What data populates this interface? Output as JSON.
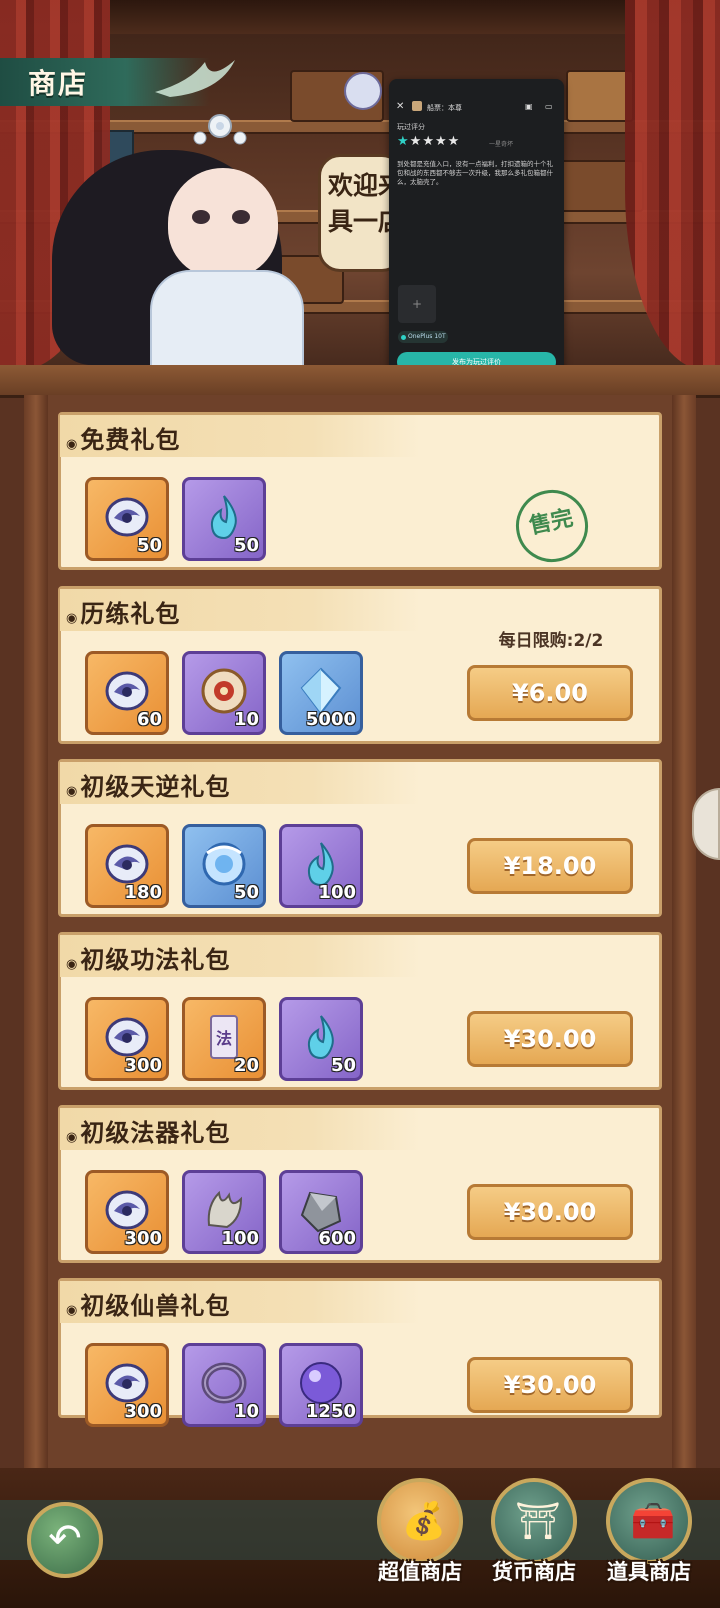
{
  "header": {
    "title": "商店"
  },
  "npc": {
    "speech": "欢迎来到\n具一店"
  },
  "review_panel": {
    "app_name": "船票：本尊",
    "section_label": "玩过评分",
    "stars_filled": 1,
    "stars_total": 5,
    "rating_hint": "一星奇坏",
    "body": "到处都是充值入口，没有一点福利，打扣遗箱的十个礼包和战的东西都不够去一次升级，我那么多礼包箱都什么，太脑壳了。",
    "add_symbol": "+",
    "device_tag": "OnePlus 10T",
    "submit_label": "发布为玩过评价"
  },
  "packs": [
    {
      "title": "免费礼包",
      "items": [
        {
          "type": "spirit-orb",
          "bg": "orange",
          "count": "50"
        },
        {
          "type": "blue-flame",
          "bg": "purple",
          "count": "50"
        }
      ],
      "status": "sold-out",
      "stamp": "售完"
    },
    {
      "title": "历练礼包",
      "items": [
        {
          "type": "spirit-orb",
          "bg": "orange",
          "count": "60"
        },
        {
          "type": "compass-disc",
          "bg": "purple",
          "count": "10"
        },
        {
          "type": "crystal",
          "bg": "blue",
          "count": "5000"
        }
      ],
      "limit": "每日限购:2/2",
      "price": "¥6.00"
    },
    {
      "title": "初级天逆礼包",
      "items": [
        {
          "type": "spirit-orb",
          "bg": "orange",
          "count": "180"
        },
        {
          "type": "ice-orb",
          "bg": "blue",
          "count": "50"
        },
        {
          "type": "blue-flame",
          "bg": "purple",
          "count": "100"
        }
      ],
      "price": "¥18.00"
    },
    {
      "title": "初级功法礼包",
      "items": [
        {
          "type": "spirit-orb",
          "bg": "orange",
          "count": "300"
        },
        {
          "type": "talisman",
          "bg": "orange",
          "count": "20",
          "label": "法"
        },
        {
          "type": "blue-flame",
          "bg": "purple",
          "count": "50"
        }
      ],
      "price": "¥30.00"
    },
    {
      "title": "初级法器礼包",
      "items": [
        {
          "type": "spirit-orb",
          "bg": "orange",
          "count": "300"
        },
        {
          "type": "claw-relic",
          "bg": "purple",
          "count": "100"
        },
        {
          "type": "ore",
          "bg": "purple",
          "count": "600"
        }
      ],
      "price": "¥30.00"
    },
    {
      "title": "初级仙兽礼包",
      "items": [
        {
          "type": "spirit-orb",
          "bg": "orange",
          "count": "300"
        },
        {
          "type": "ring",
          "bg": "purple",
          "count": "10"
        },
        {
          "type": "purple-pearl",
          "bg": "purple",
          "count": "1250"
        }
      ],
      "price": "¥30.00"
    }
  ],
  "nav": {
    "back_icon": "back-arrow-icon",
    "tabs": [
      {
        "label": "超值商店",
        "icon": "money-bag-icon",
        "active": true
      },
      {
        "label": "货币商店",
        "icon": "coin-pavilion-icon",
        "active": false
      },
      {
        "label": "道具商店",
        "icon": "treasure-chest-icon",
        "active": false
      }
    ]
  },
  "colors": {
    "accent_teal": "#27b6a8",
    "price_gold": "#e5a854",
    "card_bg": "#fbeed2"
  }
}
